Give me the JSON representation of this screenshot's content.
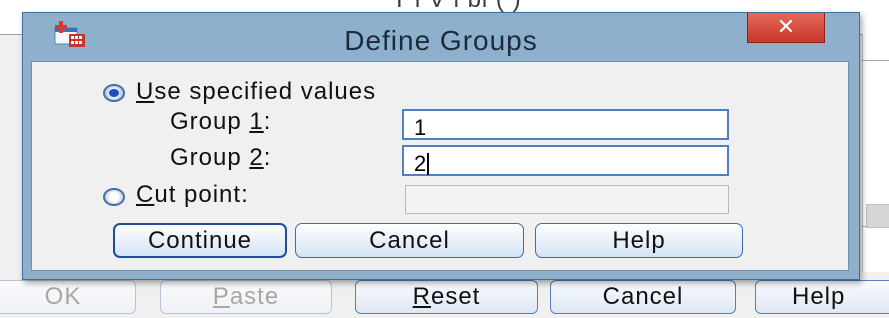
{
  "background": {
    "title_fragment": "T    l V     i  bl   ( )",
    "buttons": [
      {
        "label": "OK",
        "mnemonic": "",
        "rest": "OK",
        "disabled": true
      },
      {
        "label": "Paste",
        "mnemonic": "P",
        "rest": "aste",
        "disabled": true
      },
      {
        "label": "Reset",
        "mnemonic": "R",
        "rest": "eset",
        "disabled": false
      },
      {
        "label": "Cancel",
        "mnemonic": "",
        "rest": "Cancel",
        "disabled": false
      },
      {
        "label": "Help",
        "mnemonic": "",
        "rest": "Help",
        "disabled": false
      }
    ]
  },
  "dialog": {
    "title": "Define Groups",
    "close_symbol": "✕",
    "options": {
      "specified": {
        "mnemonic": "U",
        "rest": "se specified values",
        "selected": true
      },
      "cut_point": {
        "mnemonic": "C",
        "rest": "ut point:",
        "selected": false,
        "value": ""
      }
    },
    "group1": {
      "prefix": "Group ",
      "mnemonic": "1",
      "suffix": ":",
      "value": "1"
    },
    "group2": {
      "prefix": "Group ",
      "mnemonic": "2",
      "suffix": ":",
      "value": "2"
    },
    "buttons": {
      "continue": "Continue",
      "cancel": "Cancel",
      "help": "Help"
    }
  },
  "colors": {
    "dialog_frame": "#8fb0cd",
    "close_button": "#c9372a",
    "button_border": "#3b6bb3",
    "radio_dot": "#1a4fbf"
  },
  "icons": {
    "app": "spss-dialog-icon",
    "close": "close-icon"
  }
}
